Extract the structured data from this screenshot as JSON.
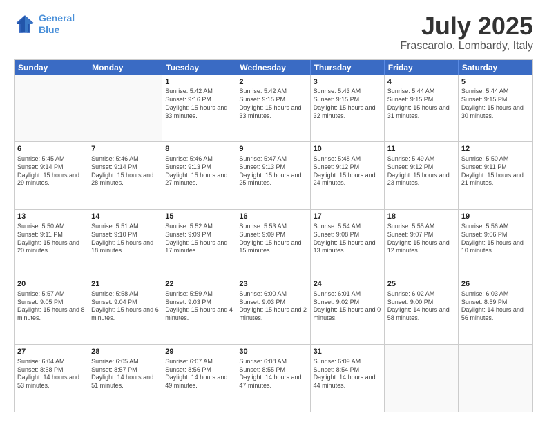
{
  "logo": {
    "line1": "General",
    "line2": "Blue"
  },
  "title": "July 2025",
  "location": "Frascarolo, Lombardy, Italy",
  "days": [
    "Sunday",
    "Monday",
    "Tuesday",
    "Wednesday",
    "Thursday",
    "Friday",
    "Saturday"
  ],
  "weeks": [
    [
      {
        "day": "",
        "empty": true
      },
      {
        "day": "",
        "empty": true
      },
      {
        "day": "1",
        "sunrise": "Sunrise: 5:42 AM",
        "sunset": "Sunset: 9:16 PM",
        "daylight": "Daylight: 15 hours and 33 minutes."
      },
      {
        "day": "2",
        "sunrise": "Sunrise: 5:42 AM",
        "sunset": "Sunset: 9:15 PM",
        "daylight": "Daylight: 15 hours and 33 minutes."
      },
      {
        "day": "3",
        "sunrise": "Sunrise: 5:43 AM",
        "sunset": "Sunset: 9:15 PM",
        "daylight": "Daylight: 15 hours and 32 minutes."
      },
      {
        "day": "4",
        "sunrise": "Sunrise: 5:44 AM",
        "sunset": "Sunset: 9:15 PM",
        "daylight": "Daylight: 15 hours and 31 minutes."
      },
      {
        "day": "5",
        "sunrise": "Sunrise: 5:44 AM",
        "sunset": "Sunset: 9:15 PM",
        "daylight": "Daylight: 15 hours and 30 minutes."
      }
    ],
    [
      {
        "day": "6",
        "sunrise": "Sunrise: 5:45 AM",
        "sunset": "Sunset: 9:14 PM",
        "daylight": "Daylight: 15 hours and 29 minutes."
      },
      {
        "day": "7",
        "sunrise": "Sunrise: 5:46 AM",
        "sunset": "Sunset: 9:14 PM",
        "daylight": "Daylight: 15 hours and 28 minutes."
      },
      {
        "day": "8",
        "sunrise": "Sunrise: 5:46 AM",
        "sunset": "Sunset: 9:13 PM",
        "daylight": "Daylight: 15 hours and 27 minutes."
      },
      {
        "day": "9",
        "sunrise": "Sunrise: 5:47 AM",
        "sunset": "Sunset: 9:13 PM",
        "daylight": "Daylight: 15 hours and 25 minutes."
      },
      {
        "day": "10",
        "sunrise": "Sunrise: 5:48 AM",
        "sunset": "Sunset: 9:12 PM",
        "daylight": "Daylight: 15 hours and 24 minutes."
      },
      {
        "day": "11",
        "sunrise": "Sunrise: 5:49 AM",
        "sunset": "Sunset: 9:12 PM",
        "daylight": "Daylight: 15 hours and 23 minutes."
      },
      {
        "day": "12",
        "sunrise": "Sunrise: 5:50 AM",
        "sunset": "Sunset: 9:11 PM",
        "daylight": "Daylight: 15 hours and 21 minutes."
      }
    ],
    [
      {
        "day": "13",
        "sunrise": "Sunrise: 5:50 AM",
        "sunset": "Sunset: 9:11 PM",
        "daylight": "Daylight: 15 hours and 20 minutes."
      },
      {
        "day": "14",
        "sunrise": "Sunrise: 5:51 AM",
        "sunset": "Sunset: 9:10 PM",
        "daylight": "Daylight: 15 hours and 18 minutes."
      },
      {
        "day": "15",
        "sunrise": "Sunrise: 5:52 AM",
        "sunset": "Sunset: 9:09 PM",
        "daylight": "Daylight: 15 hours and 17 minutes."
      },
      {
        "day": "16",
        "sunrise": "Sunrise: 5:53 AM",
        "sunset": "Sunset: 9:09 PM",
        "daylight": "Daylight: 15 hours and 15 minutes."
      },
      {
        "day": "17",
        "sunrise": "Sunrise: 5:54 AM",
        "sunset": "Sunset: 9:08 PM",
        "daylight": "Daylight: 15 hours and 13 minutes."
      },
      {
        "day": "18",
        "sunrise": "Sunrise: 5:55 AM",
        "sunset": "Sunset: 9:07 PM",
        "daylight": "Daylight: 15 hours and 12 minutes."
      },
      {
        "day": "19",
        "sunrise": "Sunrise: 5:56 AM",
        "sunset": "Sunset: 9:06 PM",
        "daylight": "Daylight: 15 hours and 10 minutes."
      }
    ],
    [
      {
        "day": "20",
        "sunrise": "Sunrise: 5:57 AM",
        "sunset": "Sunset: 9:05 PM",
        "daylight": "Daylight: 15 hours and 8 minutes."
      },
      {
        "day": "21",
        "sunrise": "Sunrise: 5:58 AM",
        "sunset": "Sunset: 9:04 PM",
        "daylight": "Daylight: 15 hours and 6 minutes."
      },
      {
        "day": "22",
        "sunrise": "Sunrise: 5:59 AM",
        "sunset": "Sunset: 9:03 PM",
        "daylight": "Daylight: 15 hours and 4 minutes."
      },
      {
        "day": "23",
        "sunrise": "Sunrise: 6:00 AM",
        "sunset": "Sunset: 9:03 PM",
        "daylight": "Daylight: 15 hours and 2 minutes."
      },
      {
        "day": "24",
        "sunrise": "Sunrise: 6:01 AM",
        "sunset": "Sunset: 9:02 PM",
        "daylight": "Daylight: 15 hours and 0 minutes."
      },
      {
        "day": "25",
        "sunrise": "Sunrise: 6:02 AM",
        "sunset": "Sunset: 9:00 PM",
        "daylight": "Daylight: 14 hours and 58 minutes."
      },
      {
        "day": "26",
        "sunrise": "Sunrise: 6:03 AM",
        "sunset": "Sunset: 8:59 PM",
        "daylight": "Daylight: 14 hours and 56 minutes."
      }
    ],
    [
      {
        "day": "27",
        "sunrise": "Sunrise: 6:04 AM",
        "sunset": "Sunset: 8:58 PM",
        "daylight": "Daylight: 14 hours and 53 minutes."
      },
      {
        "day": "28",
        "sunrise": "Sunrise: 6:05 AM",
        "sunset": "Sunset: 8:57 PM",
        "daylight": "Daylight: 14 hours and 51 minutes."
      },
      {
        "day": "29",
        "sunrise": "Sunrise: 6:07 AM",
        "sunset": "Sunset: 8:56 PM",
        "daylight": "Daylight: 14 hours and 49 minutes."
      },
      {
        "day": "30",
        "sunrise": "Sunrise: 6:08 AM",
        "sunset": "Sunset: 8:55 PM",
        "daylight": "Daylight: 14 hours and 47 minutes."
      },
      {
        "day": "31",
        "sunrise": "Sunrise: 6:09 AM",
        "sunset": "Sunset: 8:54 PM",
        "daylight": "Daylight: 14 hours and 44 minutes."
      },
      {
        "day": "",
        "empty": true
      },
      {
        "day": "",
        "empty": true
      }
    ]
  ]
}
